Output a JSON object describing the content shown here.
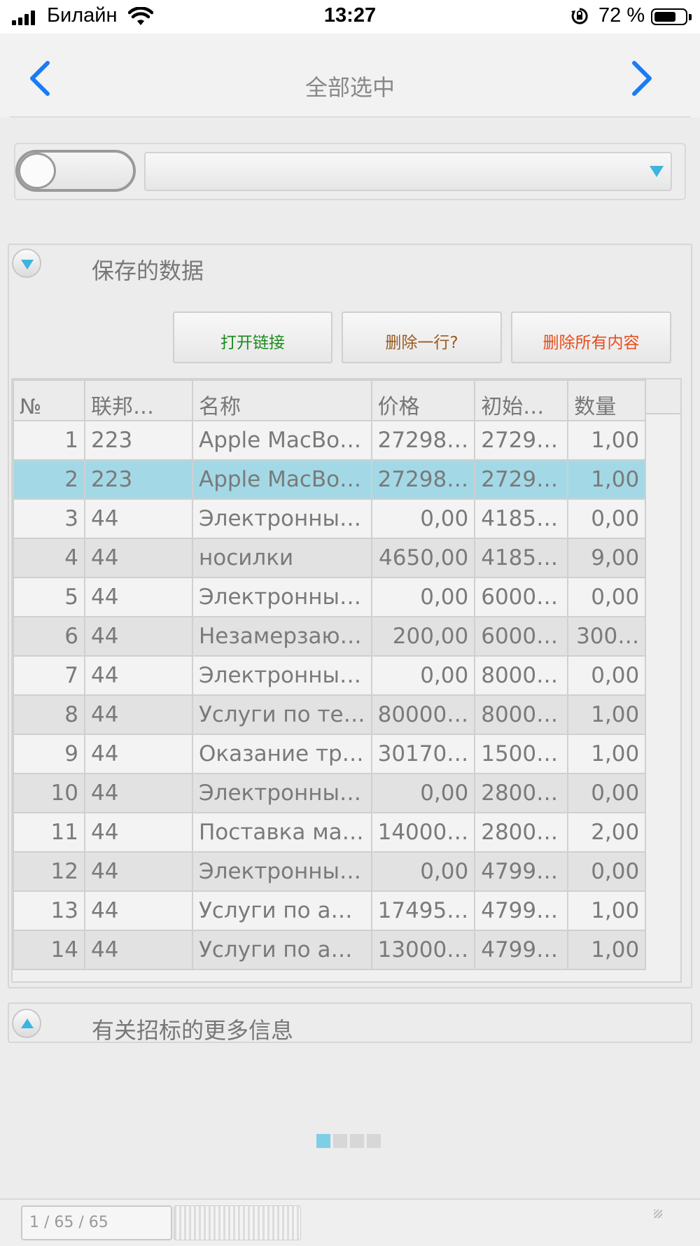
{
  "status_bar": {
    "carrier": "Билайн",
    "time": "13:27",
    "battery_percent": "72 %",
    "battery_level": 0.72
  },
  "nav": {
    "title": "全部选中",
    "back_icon": "chevron-left-icon",
    "forward_icon": "chevron-right-icon",
    "accent": "#1a7cf5"
  },
  "filter": {
    "toggle_on": false,
    "select_value": ""
  },
  "saved_panel": {
    "title": "保存的数据",
    "buttons": {
      "open_link": {
        "label": "打开链接",
        "color": "#1c8a1c"
      },
      "delete_row": {
        "label": "删除一行?",
        "color": "#9a5a1e"
      },
      "delete_all": {
        "label": "删除所有内容",
        "color": "#e84d1c"
      }
    },
    "columns": [
      "№",
      "联邦…",
      "名称",
      "价格",
      "初始…",
      "数量"
    ],
    "rows": [
      [
        "1",
        "223",
        "Apple MacBo…",
        "27298…",
        "2729…",
        "1,00"
      ],
      [
        "2",
        "223",
        "Apple MacBo…",
        "27298…",
        "2729…",
        "1,00"
      ],
      [
        "3",
        "44",
        "Электронны…",
        "0,00",
        "4185…",
        "0,00"
      ],
      [
        "4",
        "44",
        "носилки",
        "4650,00",
        "4185…",
        "9,00"
      ],
      [
        "5",
        "44",
        "Электронны…",
        "0,00",
        "6000…",
        "0,00"
      ],
      [
        "6",
        "44",
        "Незамерзаю…",
        "200,00",
        "6000…",
        "300…"
      ],
      [
        "7",
        "44",
        "Электронны…",
        "0,00",
        "8000…",
        "0,00"
      ],
      [
        "8",
        "44",
        "Услуги по те…",
        "80000…",
        "8000…",
        "1,00"
      ],
      [
        "9",
        "44",
        "Оказание тр…",
        "30170…",
        "1500…",
        "1,00"
      ],
      [
        "10",
        "44",
        "Электронны…",
        "0,00",
        "2800…",
        "0,00"
      ],
      [
        "11",
        "44",
        "Поставка ма…",
        "14000…",
        "2800…",
        "2,00"
      ],
      [
        "12",
        "44",
        "Электронны…",
        "0,00",
        "4799…",
        "0,00"
      ],
      [
        "13",
        "44",
        "Услуги по а…",
        "17495…",
        "4799…",
        "1,00"
      ],
      [
        "14",
        "44",
        "Услуги по а…",
        "13000…",
        "4799…",
        "1,00"
      ]
    ],
    "selected_row": 2
  },
  "more_panel": {
    "title": "有关招标的更多信息"
  },
  "pager": {
    "pages": 4,
    "active": 1
  },
  "footer": {
    "page_indicator": "1 / 65 / 65"
  }
}
